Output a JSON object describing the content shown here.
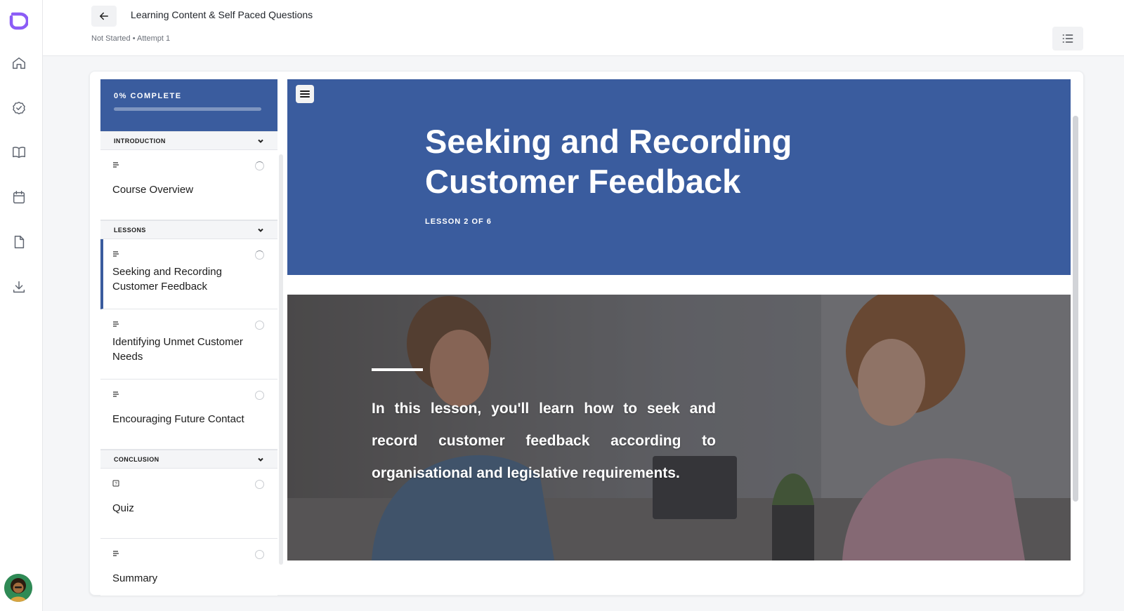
{
  "header": {
    "title": "Learning Content & Self Paced Questions",
    "meta": "Not Started • Attempt 1"
  },
  "rail": {
    "icons": [
      "logo-icon",
      "home-icon",
      "check-circle-icon",
      "book-icon",
      "calendar-icon",
      "document-icon",
      "download-icon"
    ]
  },
  "sidebar": {
    "progress_label": "0% COMPLETE",
    "progress_value": 0,
    "sections": [
      {
        "label": "INTRODUCTION",
        "items": [
          {
            "title": "Course Overview",
            "type": "text"
          }
        ]
      },
      {
        "label": "LESSONS",
        "items": [
          {
            "title": "Seeking and Recording Customer Feedback",
            "type": "text",
            "active": true
          },
          {
            "title": "Identifying Unmet Customer Needs",
            "type": "text"
          },
          {
            "title": "Encouraging Future Contact",
            "type": "text"
          }
        ]
      },
      {
        "label": "CONCLUSION",
        "items": [
          {
            "title": "Quiz",
            "type": "quiz"
          },
          {
            "title": "Summary",
            "type": "text"
          }
        ]
      }
    ]
  },
  "lesson": {
    "title": "Seeking and Recording Customer Feedback",
    "subtitle": "LESSON 2 OF 6",
    "intro": "In this lesson, you'll learn how to seek and record customer feedback according to organisational and legislative requirements."
  },
  "colors": {
    "accent": "#3a5c9e",
    "brand": "#8b5cf6"
  }
}
